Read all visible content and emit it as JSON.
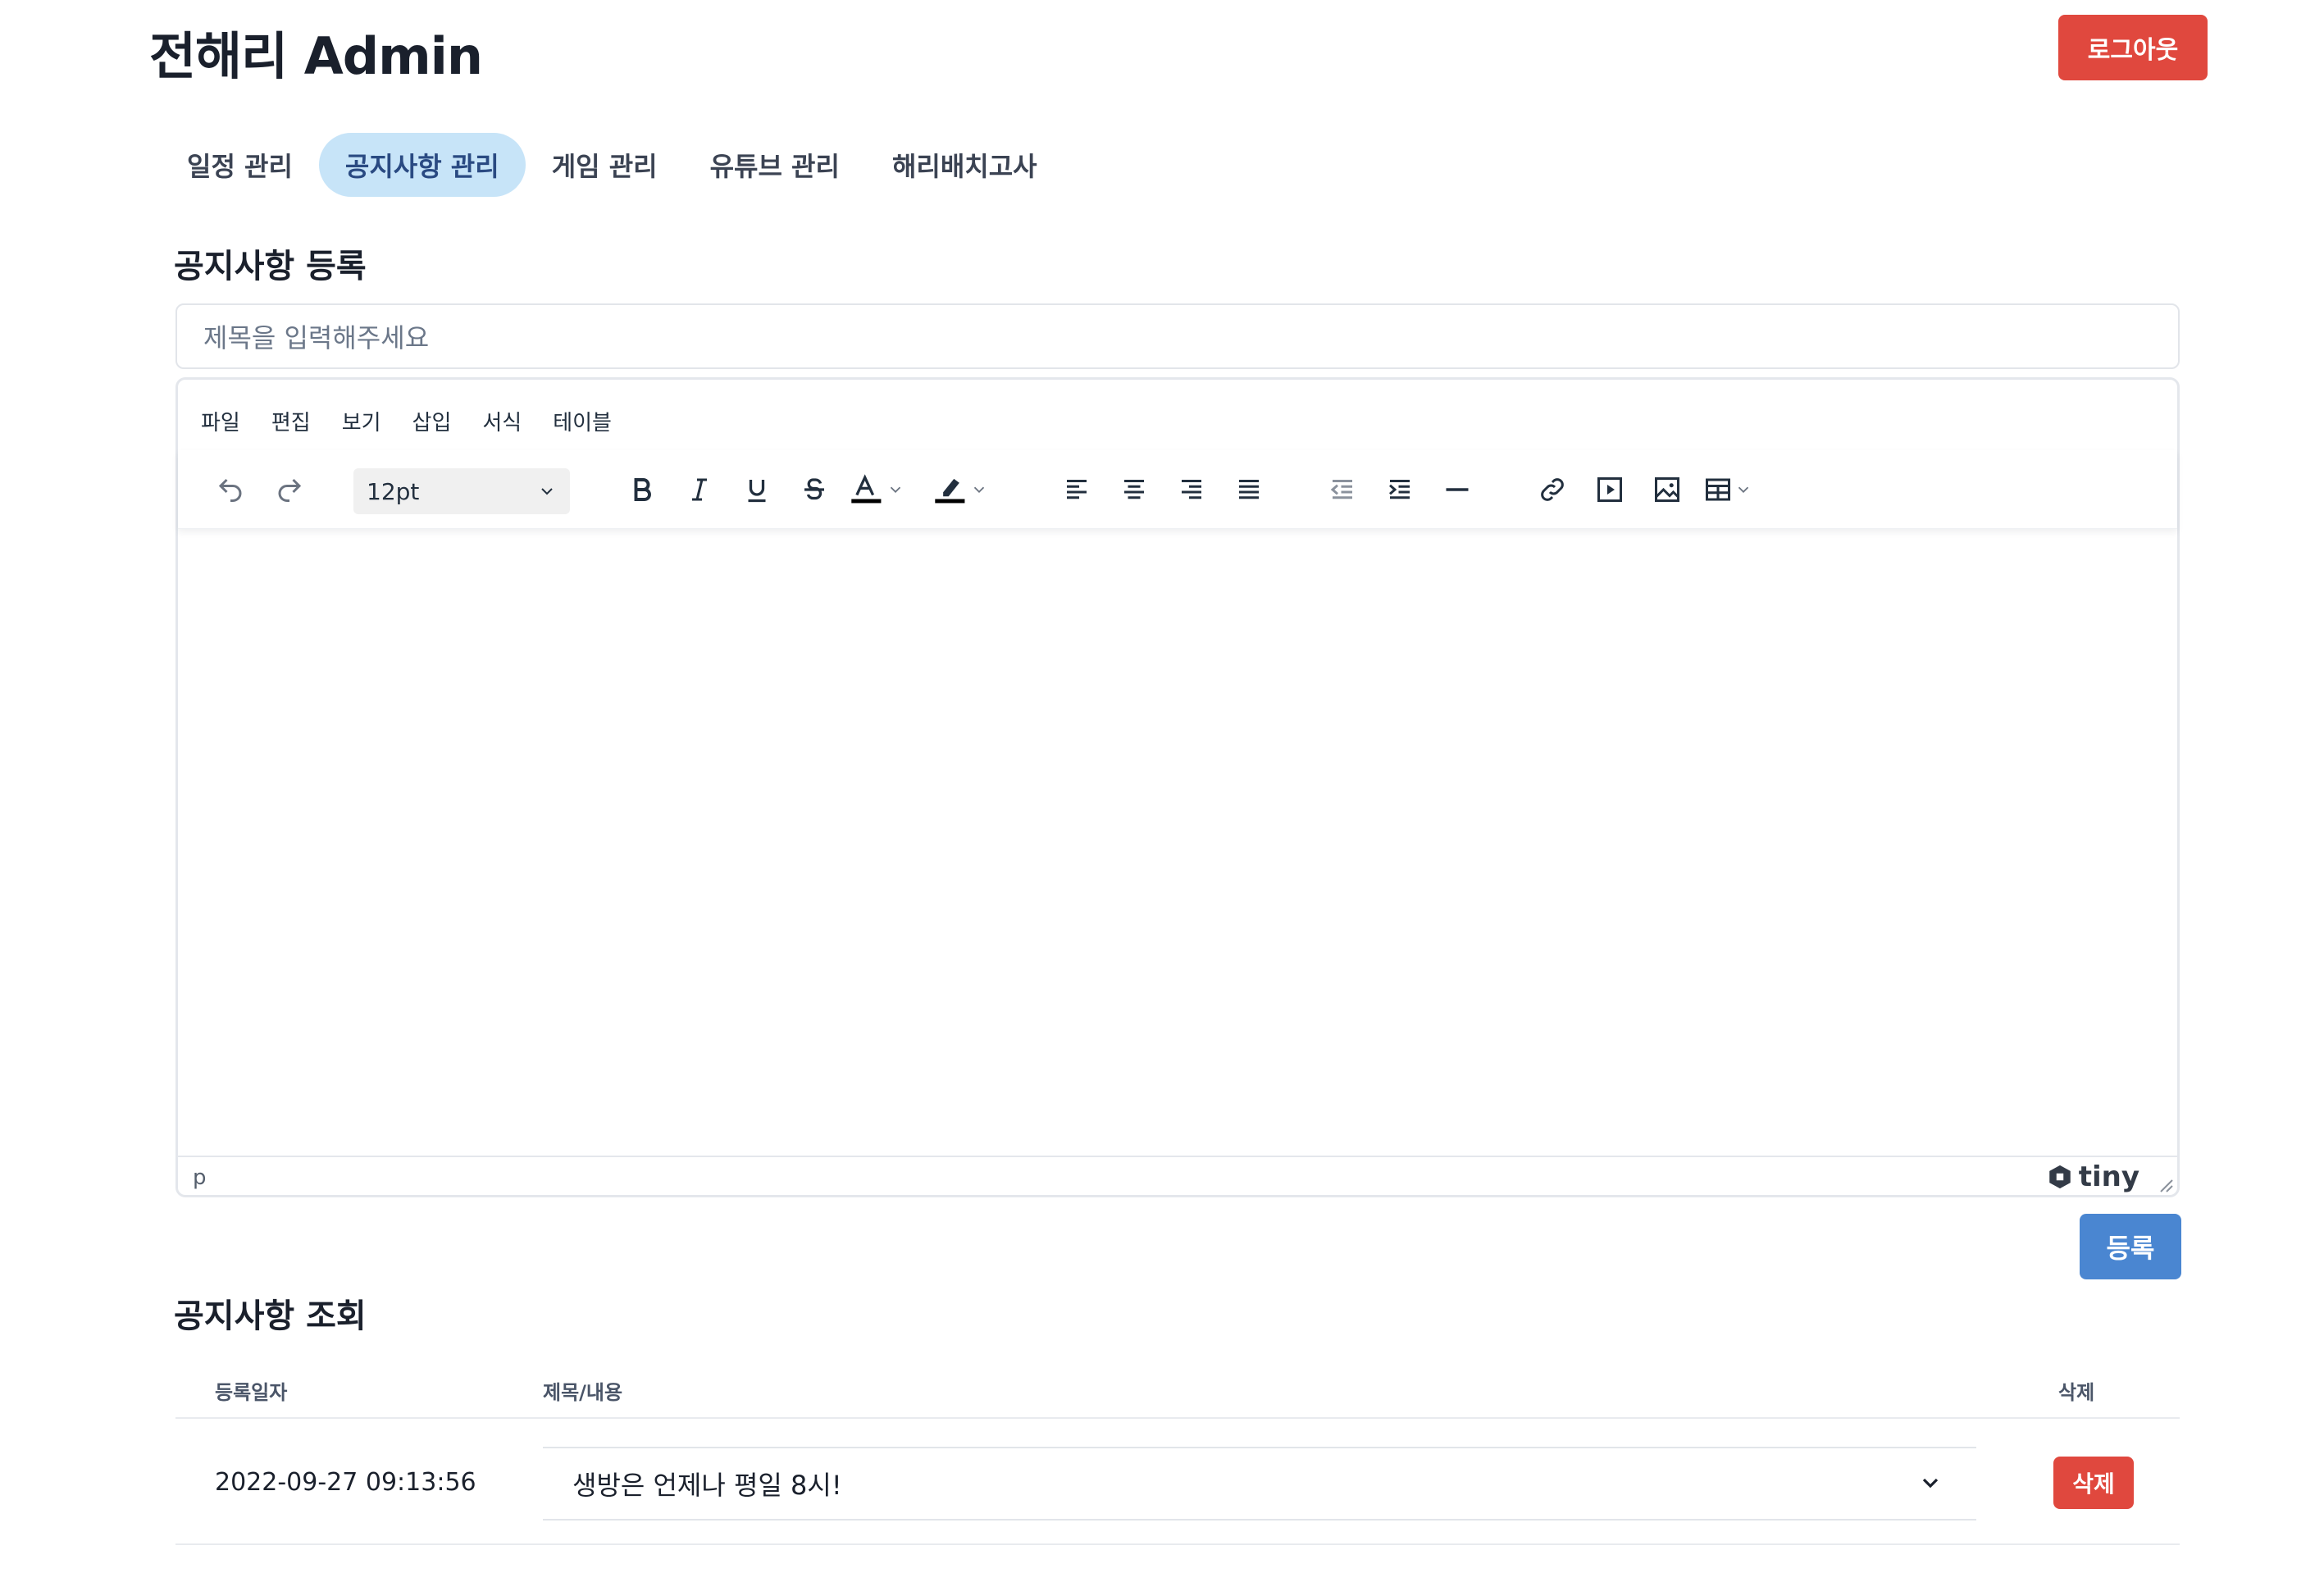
{
  "header": {
    "title": "전해리 Admin",
    "logout_label": "로그아웃"
  },
  "tabs": [
    {
      "label": "일정 관리",
      "active": false
    },
    {
      "label": "공지사항 관리",
      "active": true
    },
    {
      "label": "게임 관리",
      "active": false
    },
    {
      "label": "유튜브 관리",
      "active": false
    },
    {
      "label": "해리배치고사",
      "active": false
    }
  ],
  "register": {
    "section_title": "공지사항 등록",
    "title_placeholder": "제목을 입력해주세요",
    "submit_label": "등록"
  },
  "editor": {
    "menus": [
      "파일",
      "편집",
      "보기",
      "삽입",
      "서식",
      "테이블"
    ],
    "font_size": "12pt",
    "status_path": "p",
    "brand": "tiny",
    "toolbar_icons": [
      "undo-icon",
      "redo-icon",
      "bold-icon",
      "italic-icon",
      "underline-icon",
      "strikethrough-icon",
      "text-color-icon",
      "highlight-icon",
      "align-left-icon",
      "align-center-icon",
      "align-right-icon",
      "align-justify-icon",
      "outdent-icon",
      "indent-icon",
      "horizontal-rule-icon",
      "link-icon",
      "media-icon",
      "image-icon",
      "table-icon"
    ]
  },
  "list": {
    "section_title": "공지사항 조회",
    "columns": {
      "date": "등록일자",
      "title": "제목/내용",
      "delete": "삭제"
    },
    "rows": [
      {
        "date": "2022-09-27 09:13:56",
        "title": "생방은 언제나 평일 8시!",
        "delete_label": "삭제"
      }
    ]
  },
  "colors": {
    "danger": "#e0483e",
    "primary": "#4a86d1",
    "tab_active_bg": "#c7e4f8"
  }
}
